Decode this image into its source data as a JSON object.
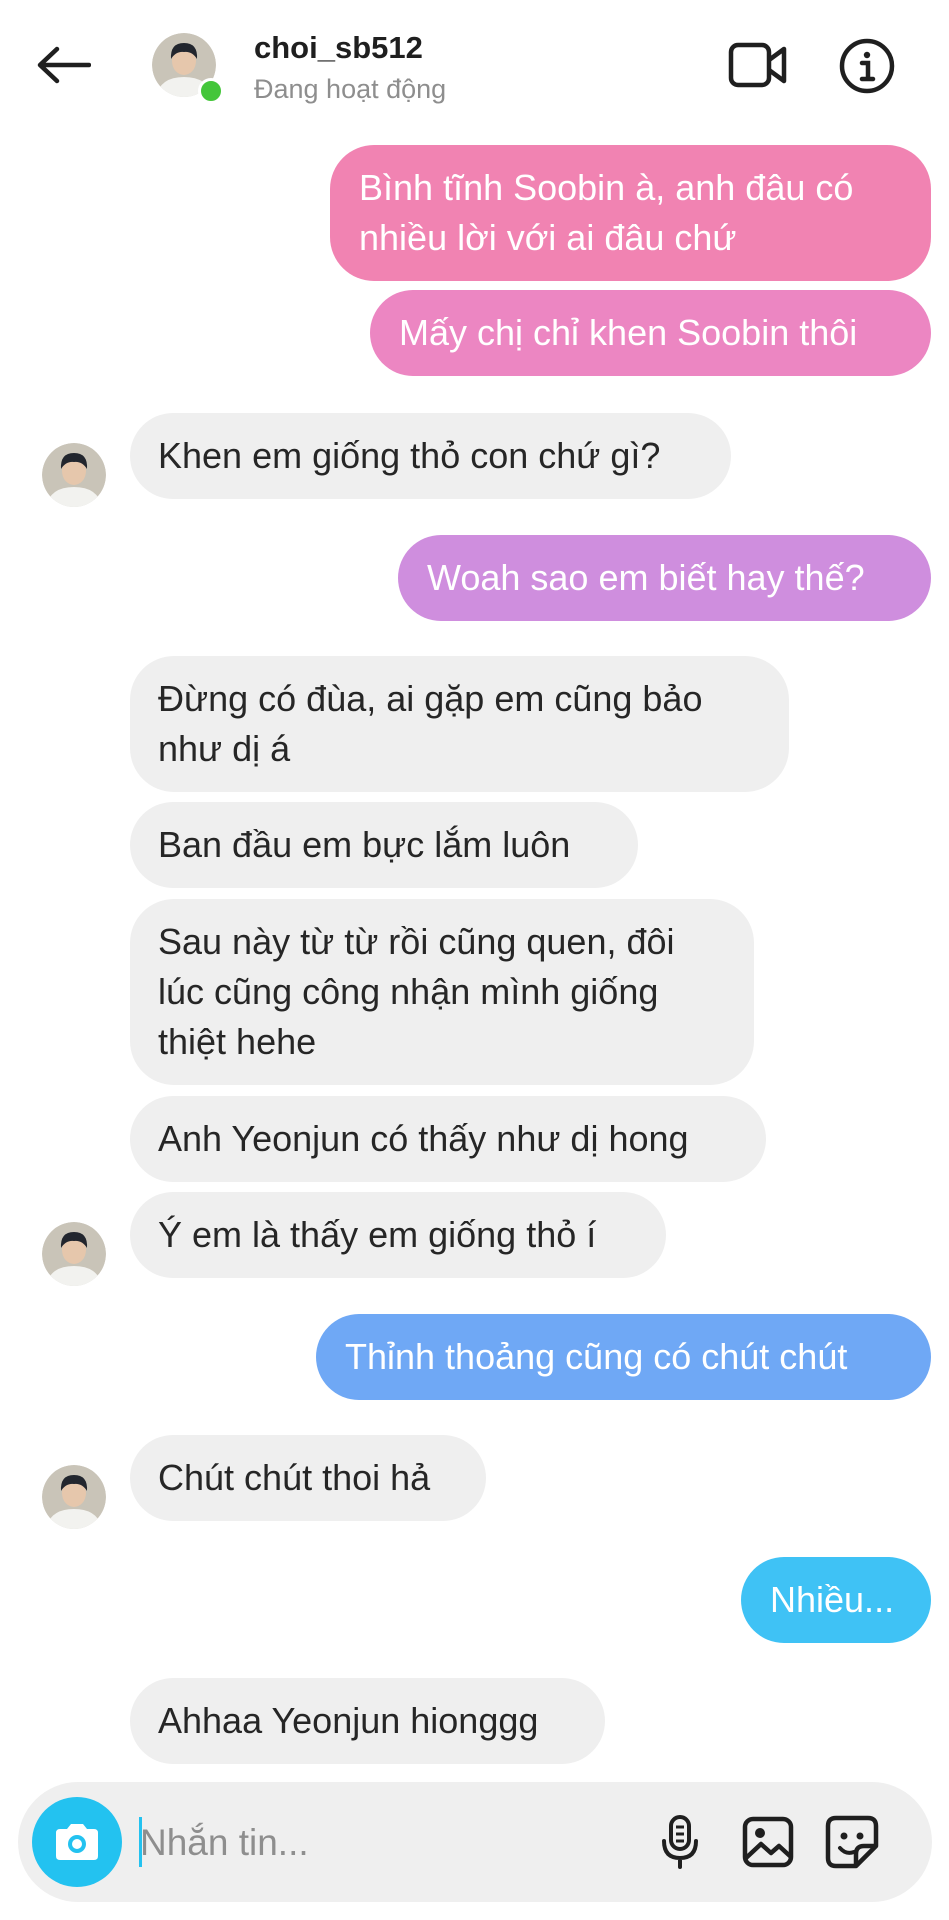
{
  "header": {
    "username": "choi_sb512",
    "status": "Đang hoạt động"
  },
  "messages": [
    {
      "side": "out",
      "text": "Bình tĩnh Soobin à, anh đâu có\nnhiều lời với ai đâu chứ",
      "color": "#f183b2"
    },
    {
      "side": "out",
      "text": "Mấy chị chỉ khen Soobin thôi",
      "color": "#ec86c2"
    },
    {
      "side": "in",
      "text": "Khen em giống thỏ con chứ gì?"
    },
    {
      "side": "out",
      "text": "Woah sao em biết hay thế?",
      "color": "#cf8ede"
    },
    {
      "side": "in",
      "text": "Đừng có đùa, ai gặp em cũng bảo\nnhư dị á"
    },
    {
      "side": "in",
      "text": "Ban đầu em bực lắm luôn"
    },
    {
      "side": "in",
      "text": "Sau này từ từ rồi cũng quen, đôi\nlúc cũng công nhận mình giống\nthiệt hehe"
    },
    {
      "side": "in",
      "text": "Anh Yeonjun có thấy như dị hong"
    },
    {
      "side": "in",
      "text": "Ý em là thấy em giống thỏ í"
    },
    {
      "side": "out",
      "text": "Thỉnh thoảng cũng có chút chút",
      "color": "#6fa8f5"
    },
    {
      "side": "in",
      "text": "Chút chút thoi hả"
    },
    {
      "side": "out",
      "text": "Nhiều...",
      "color": "#3fc2f5"
    },
    {
      "side": "in",
      "text": "Ahhaa Yeonjun hionggg"
    }
  ],
  "composer": {
    "placeholder": "Nhắn tin..."
  },
  "icons": {
    "back": "arrow-left-icon",
    "video": "video-camera-icon",
    "info": "info-icon",
    "camera": "camera-icon",
    "mic": "microphone-icon",
    "gallery": "image-icon",
    "sticker": "sticker-icon"
  },
  "colors": {
    "incoming_bubble": "#efefef",
    "online": "#44c63a",
    "camera_button": "#23c2f0"
  }
}
